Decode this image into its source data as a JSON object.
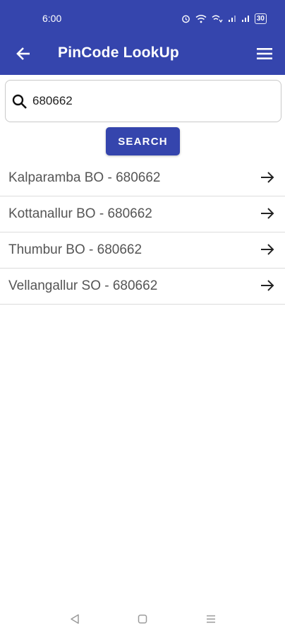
{
  "status_bar": {
    "time": "6:00",
    "battery": "30"
  },
  "app_bar": {
    "title": "PinCode LookUp",
    "back_icon": "arrow-left-icon",
    "menu_icon": "hamburger-menu-icon"
  },
  "search": {
    "value": "680662",
    "icon": "search-icon",
    "button_label": "SEARCH"
  },
  "results": [
    {
      "label": "Kalparamba BO - 680662"
    },
    {
      "label": "Kottanallur BO - 680662"
    },
    {
      "label": "Thumbur BO - 680662"
    },
    {
      "label": "Vellangallur SO - 680662"
    }
  ],
  "nav_bar": {
    "back": "triangle-back-icon",
    "home": "square-home-icon",
    "recents": "three-lines-recents-icon"
  },
  "colors": {
    "primary": "#3545ad",
    "text_secondary": "#555555",
    "divider": "#dcdcdc"
  }
}
